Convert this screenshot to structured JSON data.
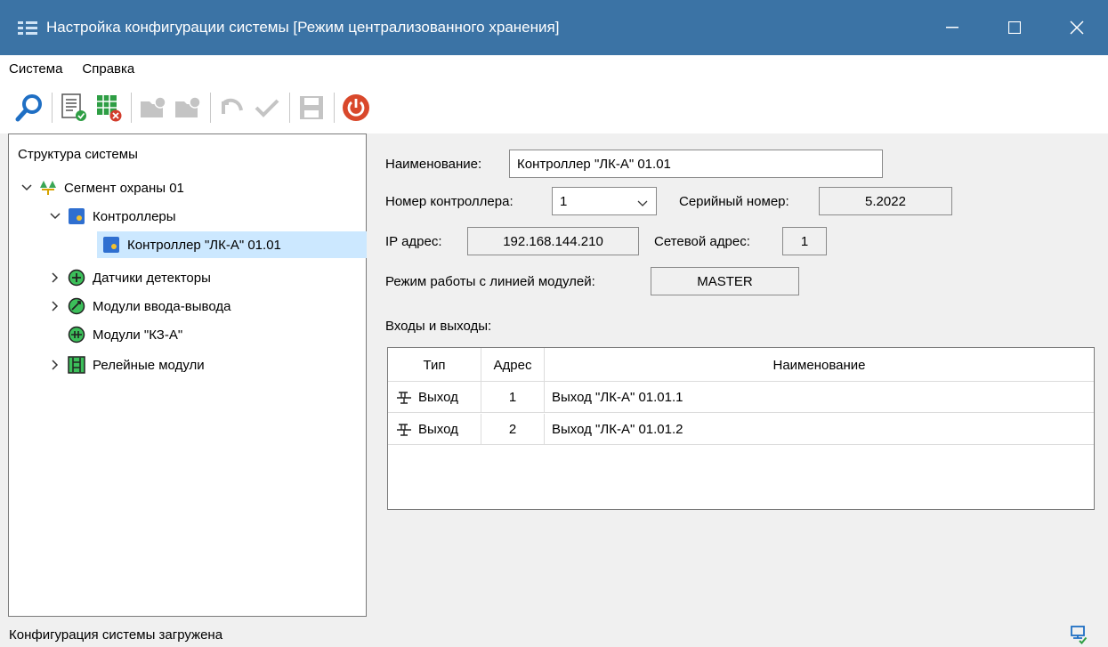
{
  "window": {
    "title": "Настройка конфигурации системы [Режим централизованного хранения]",
    "title_bar_color": "#3b73a5"
  },
  "menu": [
    "Система",
    "Справка"
  ],
  "toolbar": {
    "buttons": [
      {
        "icon": "search-icon"
      },
      {
        "icon": "document-check-icon"
      },
      {
        "icon": "grid-delete-icon"
      },
      {
        "icon": "folder-disabled-icon"
      },
      {
        "icon": "folder-disabled-icon"
      },
      {
        "icon": "undo-disabled-icon"
      },
      {
        "icon": "check-disabled-icon"
      },
      {
        "icon": "save-disabled-icon"
      },
      {
        "icon": "power-icon"
      }
    ]
  },
  "tree": {
    "title": "Структура системы",
    "items": [
      {
        "label": "Сегмент охраны 01",
        "icon": "segment-icon",
        "expander": "expanded"
      },
      {
        "label": "Контроллеры",
        "icon": "controller-icon",
        "expander": "expanded"
      },
      {
        "label": "Контроллер \"ЛК-А\" 01.01",
        "icon": "controller-icon",
        "expander": "none",
        "selected": true
      },
      {
        "label": "Датчики детекторы",
        "icon": "sensor-icon",
        "expander": "collapsed"
      },
      {
        "label": "Модули ввода-вывода",
        "icon": "io-module-icon",
        "expander": "collapsed"
      },
      {
        "label": "Модули \"КЗ-А\"",
        "icon": "kz-module-icon",
        "expander": "none"
      },
      {
        "label": "Релейные модули",
        "icon": "relay-module-icon",
        "expander": "collapsed"
      }
    ]
  },
  "form": {
    "name_label": "Наименование:",
    "name_value": "Контроллер \"ЛК-А\" 01.01",
    "controller_num_label": "Номер контроллера:",
    "controller_num_value": "1",
    "serial_label": "Серийный номер:",
    "serial_value": "5.2022",
    "ip_label": "IP адрес:",
    "ip_value": "192.168.144.210",
    "net_addr_label": "Сетевой адрес:",
    "net_addr_value": "1",
    "mode_label": "Режим работы с линией модулей:",
    "mode_value": "MASTER",
    "io_label": "Входы и выходы:"
  },
  "io_table": {
    "columns": [
      "Тип",
      "Адрес",
      "Наименование"
    ],
    "rows": [
      {
        "type": "Выход",
        "icon": "output-icon",
        "address": "1",
        "name": "Выход \"ЛК-А\" 01.01.1"
      },
      {
        "type": "Выход",
        "icon": "output-icon",
        "address": "2",
        "name": "Выход \"ЛК-А\" 01.01.2"
      }
    ]
  },
  "status": {
    "text": "Конфигурация системы загружена",
    "icon": "network-ok-icon"
  }
}
